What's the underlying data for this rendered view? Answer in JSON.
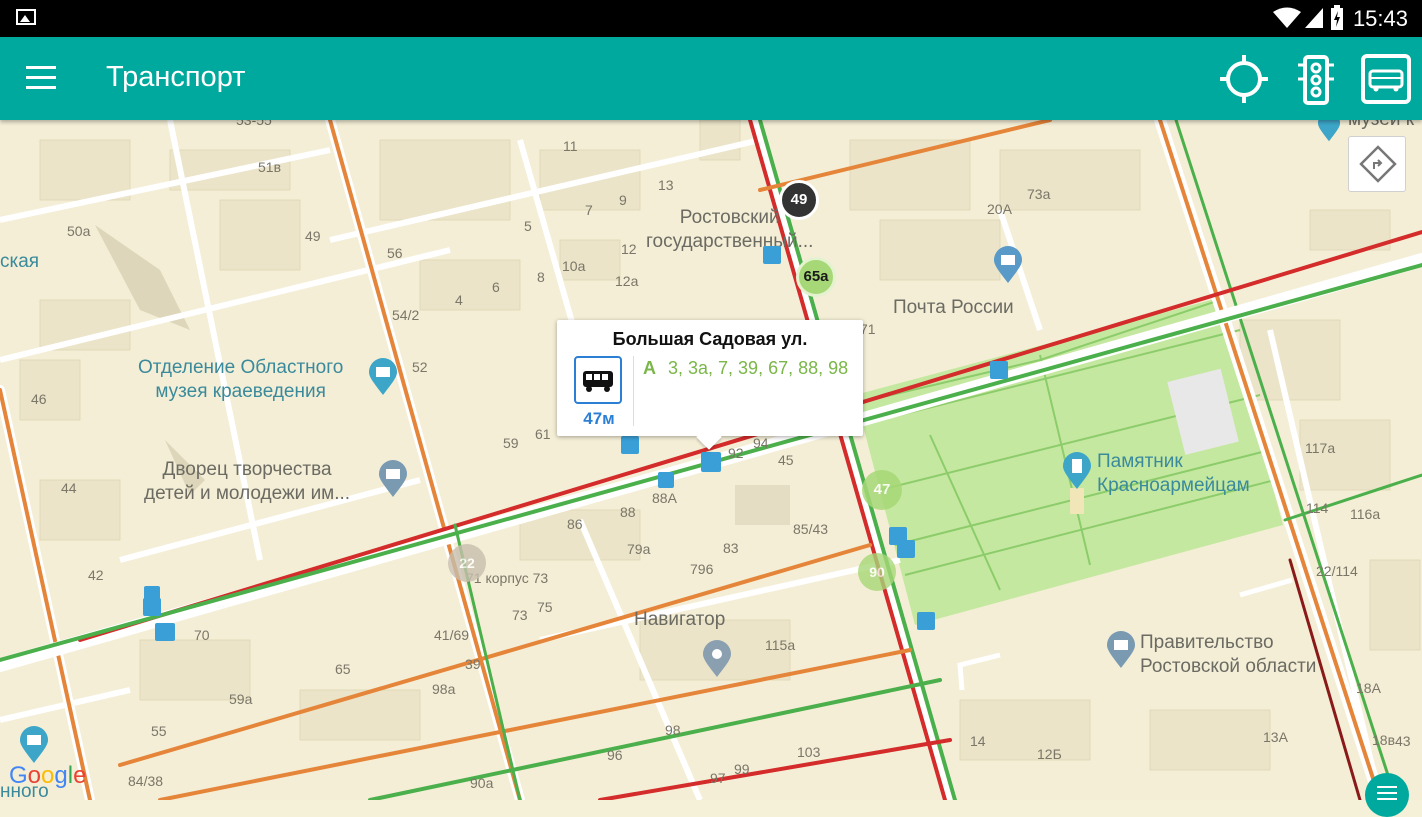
{
  "status_bar": {
    "time": "15:43",
    "icons": [
      "gallery-icon",
      "wifi-icon",
      "sim-icon",
      "battery-icon"
    ]
  },
  "app_bar": {
    "title": "Транспорт",
    "icons": [
      "menu-icon",
      "location-icon",
      "traffic-light-icon",
      "bus-filter-icon"
    ]
  },
  "colors": {
    "app_bar": "#00a99d",
    "route_green": "#7ab648",
    "bus_blue": "#2b7fd4",
    "park": "#c5e8a0"
  },
  "popup": {
    "stop_name": "Большая Садовая ул.",
    "distance": "47м",
    "transport_type": "А",
    "routes": "3, 3а, 7, 39, 67, 88, 98"
  },
  "vehicle_markers": [
    {
      "label": "49",
      "color": "#333333"
    },
    {
      "label": "65а",
      "color": "#8dc63f"
    },
    {
      "label": "47",
      "color": "#8dc63f"
    },
    {
      "label": "22",
      "color": "#a89c8a"
    },
    {
      "label": "90",
      "color": "#8dc63f"
    }
  ],
  "map": {
    "pois": [
      {
        "name": "Ростовский\nгосударственный...",
        "style": "poi"
      },
      {
        "name": "Почта России",
        "style": "poi"
      },
      {
        "name": "Отделение Областного\nмузея краеведения",
        "style": "poi-teal"
      },
      {
        "name": "Дворец творчества\nдетей и молодежи им...",
        "style": "poi"
      },
      {
        "name": "Памятник\nКрасноармейцам",
        "style": "poi-teal"
      },
      {
        "name": "Навигатор",
        "style": "poi"
      },
      {
        "name": "Правительство\nРостовской области",
        "style": "poi"
      },
      {
        "name": "ская",
        "style": "poi-teal"
      },
      {
        "name": "музей к",
        "style": "poi"
      },
      {
        "name": "нного",
        "style": "poi-teal"
      }
    ],
    "numbers": [
      "53-55",
      "51в",
      "50а",
      "49",
      "11",
      "13",
      "7",
      "9",
      "5",
      "56",
      "12",
      "10а",
      "8",
      "6",
      "4",
      "12а",
      "54/2",
      "52",
      "46",
      "44",
      "42",
      "59",
      "61",
      "94",
      "92",
      "45",
      "88А",
      "88",
      "86",
      "85/43",
      "79а",
      "83",
      "796",
      "71 корпус 73",
      "73",
      "75",
      "70",
      "41/69",
      "65",
      "39",
      "59а",
      "98а",
      "55",
      "98",
      "115а",
      "96",
      "103",
      "97",
      "99",
      "84/38",
      "90а",
      "20А",
      "73а",
      "71",
      "117а",
      "114",
      "116а",
      "22/114",
      "18А",
      "14",
      "12Б",
      "13А",
      "18в",
      "43"
    ]
  },
  "google_logo": "Google"
}
